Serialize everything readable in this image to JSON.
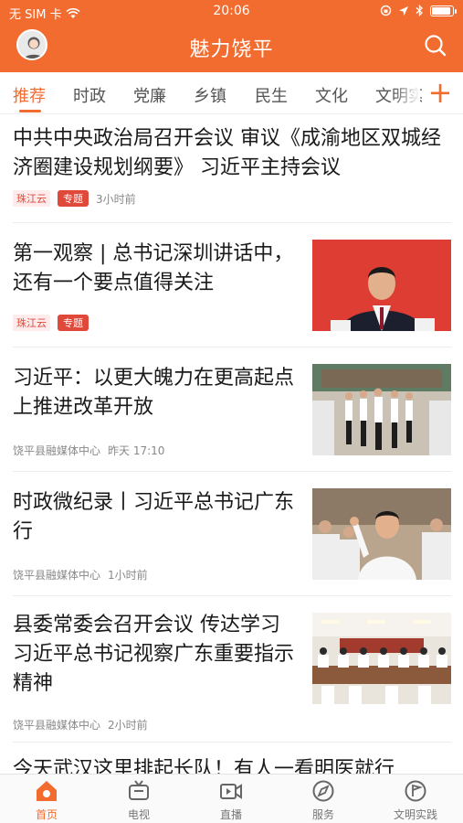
{
  "status_bar": {
    "carrier": "无 SIM 卡",
    "time": "20:06",
    "battery_level": 0.85
  },
  "header": {
    "title": "魅力饶平"
  },
  "tabs": [
    {
      "label": "推荐",
      "active": true
    },
    {
      "label": "时政",
      "active": false
    },
    {
      "label": "党廉",
      "active": false
    },
    {
      "label": "乡镇",
      "active": false
    },
    {
      "label": "民生",
      "active": false
    },
    {
      "label": "文化",
      "active": false
    },
    {
      "label": "文明实",
      "active": false
    }
  ],
  "tab_add_label": "+",
  "feed": [
    {
      "title": "中共中央政治局召开会议 审议《成渝地区双城经济圈建设规划纲要》 习近平主持会议",
      "source": "珠江云",
      "special": "专题",
      "time": "3小时前"
    },
    {
      "title": "第一观察 | 总书记深圳讲话中，还有一个要点值得关注",
      "source": "珠江云",
      "special": "专题",
      "time": "",
      "image": "portrait-red"
    },
    {
      "title": "习近平：以更大魄力在更高起点上推进改革开放",
      "source": "饶平县融媒体中心",
      "time": "昨天 17:10",
      "image": "walking-group"
    },
    {
      "title": "时政微纪录丨习近平总书记广东行",
      "source": "饶平县融媒体中心",
      "time": "1小时前",
      "image": "waving-crowd"
    },
    {
      "title": "县委常委会召开会议 传达学习习近平总书记视察广东重要指示精神",
      "source": "饶平县融媒体中心",
      "time": "2小时前",
      "image": "meeting-room"
    },
    {
      "title": "今天武汉这里排起长队！有人一看明医就行",
      "source": "",
      "time": ""
    }
  ],
  "tabbar": [
    {
      "label": "首页",
      "icon": "home-icon",
      "active": true
    },
    {
      "label": "电视",
      "icon": "tv-icon",
      "active": false
    },
    {
      "label": "直播",
      "icon": "live-icon",
      "active": false
    },
    {
      "label": "服务",
      "icon": "compass-icon",
      "active": false
    },
    {
      "label": "文明实践",
      "icon": "flag-icon",
      "active": false
    }
  ],
  "colors": {
    "accent": "#f26b2f",
    "tag_red": "#e0483a"
  }
}
